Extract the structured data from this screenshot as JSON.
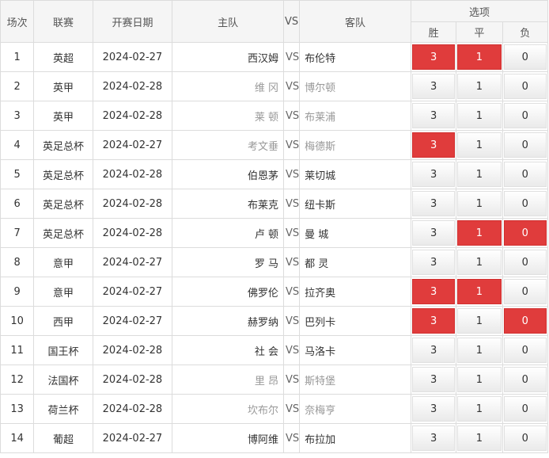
{
  "header": {
    "round": "场次",
    "league": "联赛",
    "date": "开赛日期",
    "home": "主队",
    "vs": "VS",
    "away": "客队",
    "options": "选项",
    "win": "胜",
    "draw": "平",
    "lose": "负"
  },
  "colors": {
    "selected": "#e03c3c",
    "muted_team": "#999999"
  },
  "rows": [
    {
      "no": "1",
      "league": "英超",
      "date": "2024-02-27",
      "home": "西汉姆",
      "away": "布伦特",
      "muted": false,
      "win": "3",
      "draw": "1",
      "lose": "0",
      "sel": [
        true,
        true,
        false
      ]
    },
    {
      "no": "2",
      "league": "英甲",
      "date": "2024-02-28",
      "home": "维 冈",
      "away": "博尔顿",
      "muted": true,
      "win": "3",
      "draw": "1",
      "lose": "0",
      "sel": [
        false,
        false,
        false
      ]
    },
    {
      "no": "3",
      "league": "英甲",
      "date": "2024-02-28",
      "home": "莱 顿",
      "away": "布莱浦",
      "muted": true,
      "win": "3",
      "draw": "1",
      "lose": "0",
      "sel": [
        false,
        false,
        false
      ]
    },
    {
      "no": "4",
      "league": "英足总杯",
      "date": "2024-02-27",
      "home": "考文垂",
      "away": "梅德斯",
      "muted": true,
      "win": "3",
      "draw": "1",
      "lose": "0",
      "sel": [
        true,
        false,
        false
      ]
    },
    {
      "no": "5",
      "league": "英足总杯",
      "date": "2024-02-28",
      "home": "伯恩茅",
      "away": "莱切城",
      "muted": false,
      "win": "3",
      "draw": "1",
      "lose": "0",
      "sel": [
        false,
        false,
        false
      ]
    },
    {
      "no": "6",
      "league": "英足总杯",
      "date": "2024-02-28",
      "home": "布莱克",
      "away": "纽卡斯",
      "muted": false,
      "win": "3",
      "draw": "1",
      "lose": "0",
      "sel": [
        false,
        false,
        false
      ]
    },
    {
      "no": "7",
      "league": "英足总杯",
      "date": "2024-02-28",
      "home": "卢 顿",
      "away": "曼 城",
      "muted": false,
      "win": "3",
      "draw": "1",
      "lose": "0",
      "sel": [
        false,
        true,
        true
      ]
    },
    {
      "no": "8",
      "league": "意甲",
      "date": "2024-02-27",
      "home": "罗 马",
      "away": "都 灵",
      "muted": false,
      "win": "3",
      "draw": "1",
      "lose": "0",
      "sel": [
        false,
        false,
        false
      ]
    },
    {
      "no": "9",
      "league": "意甲",
      "date": "2024-02-27",
      "home": "佛罗伦",
      "away": "拉齐奥",
      "muted": false,
      "win": "3",
      "draw": "1",
      "lose": "0",
      "sel": [
        true,
        true,
        false
      ]
    },
    {
      "no": "10",
      "league": "西甲",
      "date": "2024-02-27",
      "home": "赫罗纳",
      "away": "巴列卡",
      "muted": false,
      "win": "3",
      "draw": "1",
      "lose": "0",
      "sel": [
        true,
        false,
        true
      ]
    },
    {
      "no": "11",
      "league": "国王杯",
      "date": "2024-02-28",
      "home": "社 会",
      "away": "马洛卡",
      "muted": false,
      "win": "3",
      "draw": "1",
      "lose": "0",
      "sel": [
        false,
        false,
        false
      ]
    },
    {
      "no": "12",
      "league": "法国杯",
      "date": "2024-02-28",
      "home": "里 昂",
      "away": "斯特堡",
      "muted": true,
      "win": "3",
      "draw": "1",
      "lose": "0",
      "sel": [
        false,
        false,
        false
      ]
    },
    {
      "no": "13",
      "league": "荷兰杯",
      "date": "2024-02-28",
      "home": "坎布尔",
      "away": "奈梅亨",
      "muted": true,
      "win": "3",
      "draw": "1",
      "lose": "0",
      "sel": [
        false,
        false,
        false
      ]
    },
    {
      "no": "14",
      "league": "葡超",
      "date": "2024-02-27",
      "home": "博阿维",
      "away": "布拉加",
      "muted": false,
      "win": "3",
      "draw": "1",
      "lose": "0",
      "sel": [
        false,
        false,
        false
      ]
    }
  ]
}
